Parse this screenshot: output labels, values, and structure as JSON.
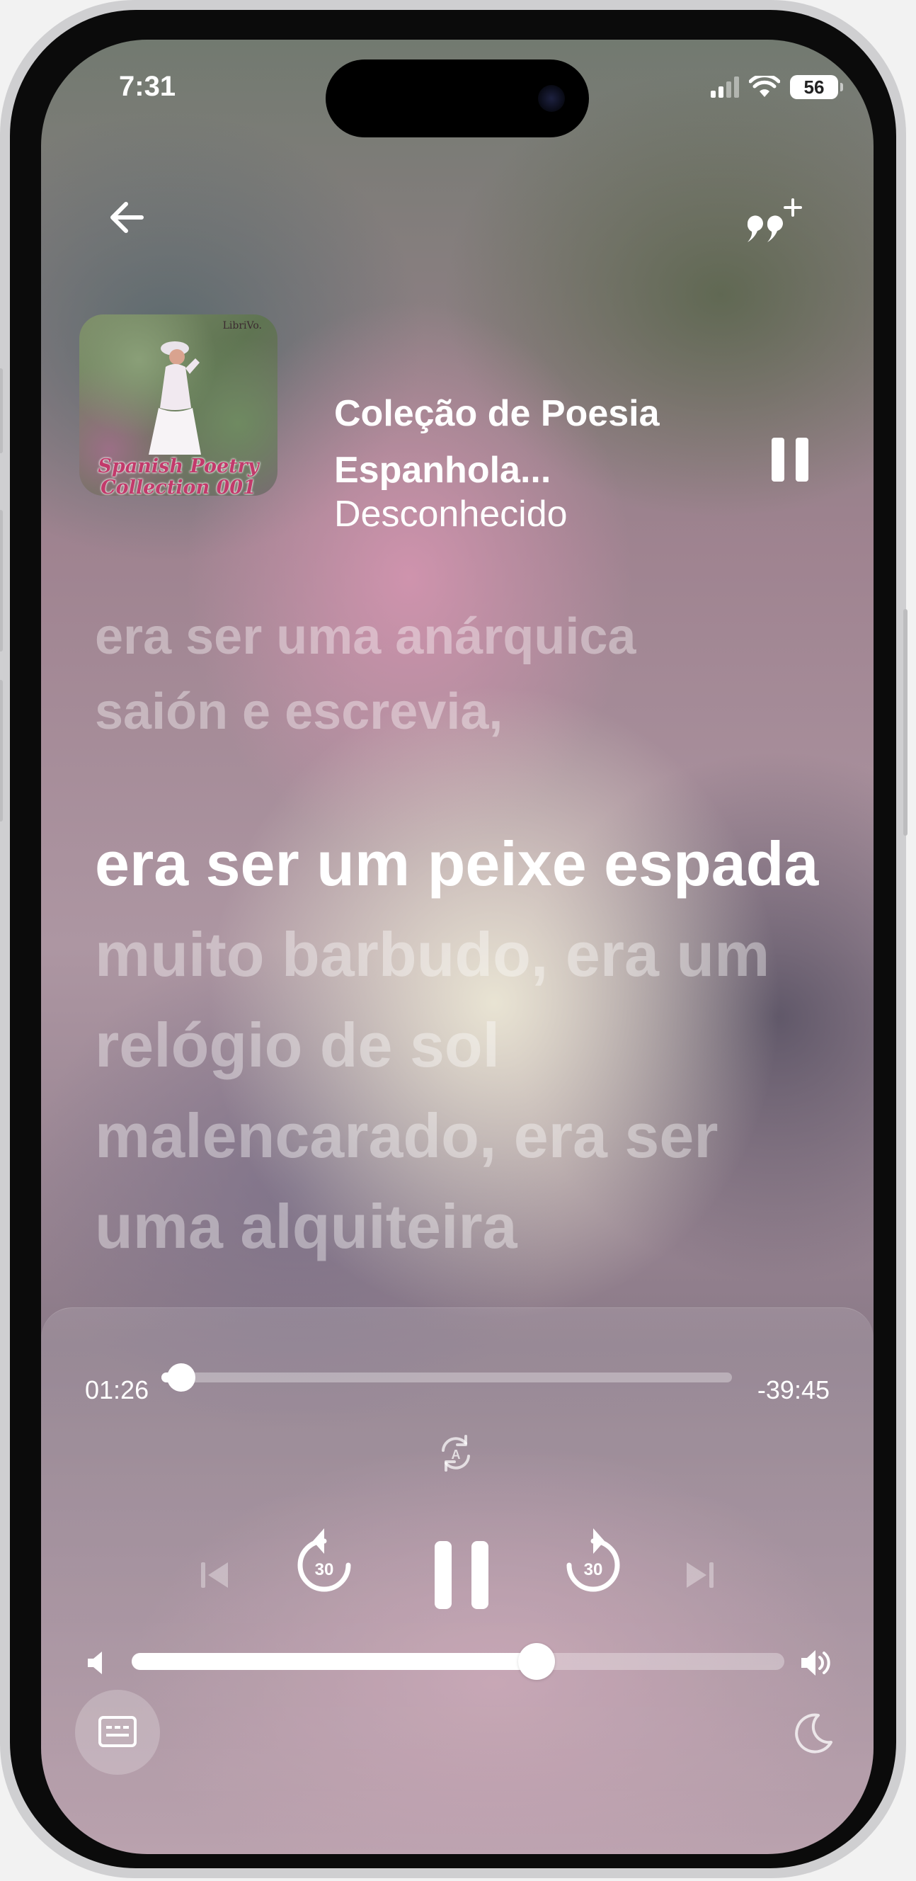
{
  "status_bar": {
    "time": "7:31",
    "battery": "56"
  },
  "header": {
    "back_icon": "arrow-left-icon",
    "quote_icon": "quote-plus-icon"
  },
  "now_playing": {
    "cover_lines": [
      "Spanish Poetry",
      "Collection 001"
    ],
    "cover_tag": "LibriVo.",
    "title_line1": "Coleção de Poesia",
    "title_line2": "Espanhola...",
    "artist": "Desconhecido",
    "state": "playing"
  },
  "lyrics": {
    "previous": [
      "era ser uma anárquica",
      "saión e escrevia,"
    ],
    "current_sung": "era ser um peixe espada",
    "current_rest": "muito barbudo, era um relógio de sol malencarado, era ser uma alquiteira"
  },
  "player": {
    "elapsed": "01:26",
    "remaining": "-39:45",
    "progress": 0.035,
    "skip_back_seconds": "30",
    "skip_forward_seconds": "30",
    "volume": 0.62,
    "accent_color": "#ffffff"
  }
}
